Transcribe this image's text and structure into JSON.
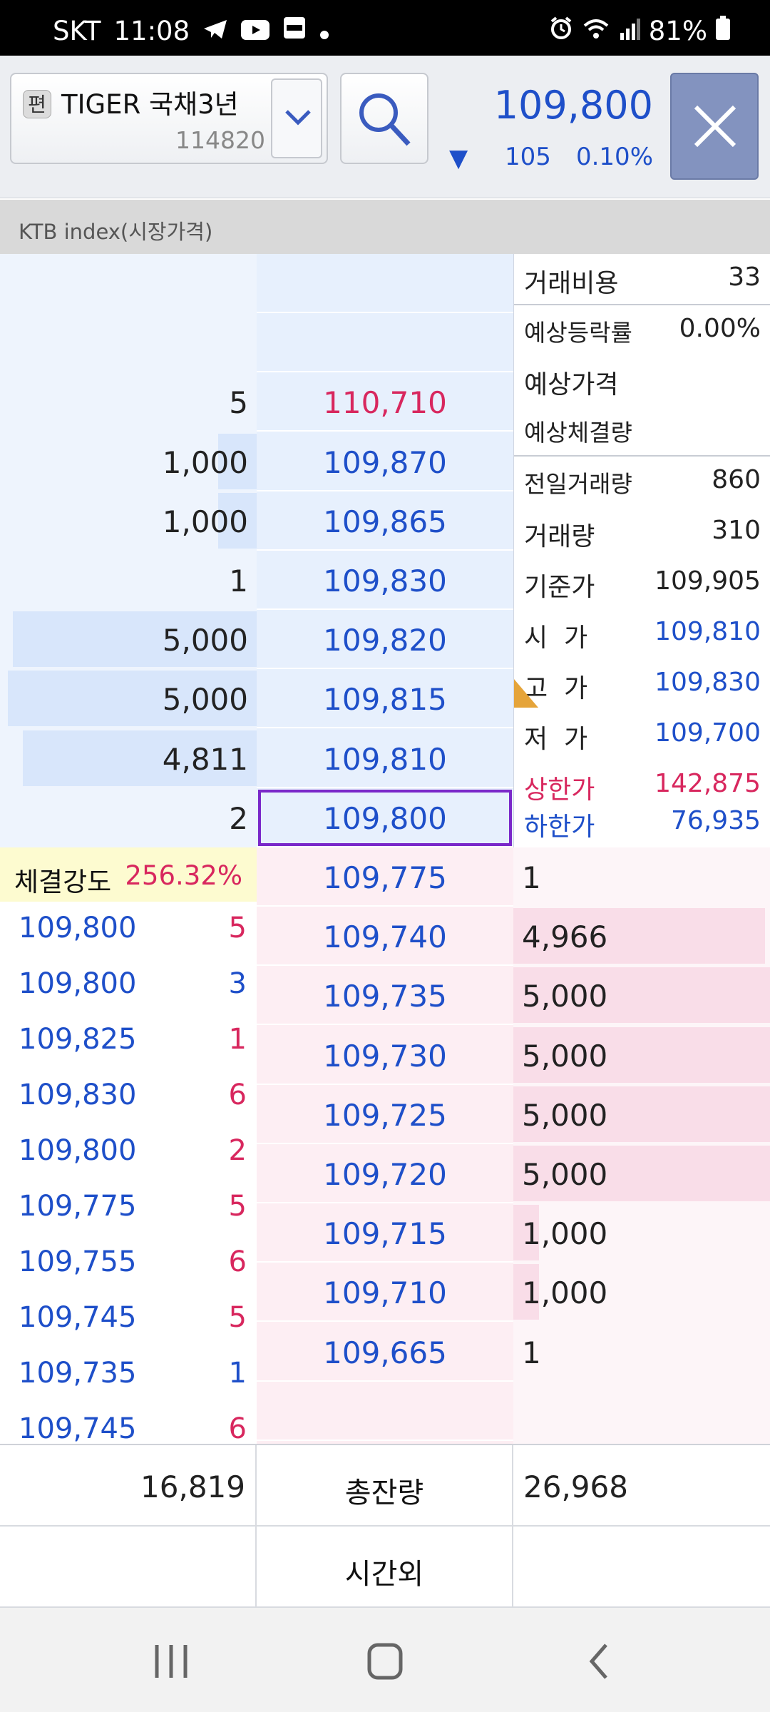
{
  "status_bar": {
    "carrier": "SKT",
    "time": "11:08",
    "battery": "81%",
    "left_icons": [
      "telegram-icon",
      "youtube-icon",
      "payco-icon",
      "dot-icon"
    ],
    "right_icons": [
      "alarm-icon",
      "wifi-icon",
      "signal-icon",
      "battery-icon"
    ]
  },
  "header": {
    "edit_badge": "편",
    "stock_name": "TIGER 국채3년",
    "stock_code": "114820",
    "current_price": "109,800",
    "change_arrow": "▼",
    "change_amount": "105",
    "change_rate": "0.10%"
  },
  "index_bar": {
    "label": "KTB index(시장가격)"
  },
  "ask_levels": [
    {
      "qty": "",
      "price": "",
      "fill": 0
    },
    {
      "qty": "",
      "price": "",
      "fill": 0
    },
    {
      "qty": "5",
      "price": "110,710",
      "fill": 0,
      "color": "#d8275e"
    },
    {
      "qty": "1,000",
      "price": "109,870",
      "fill": 0.15
    },
    {
      "qty": "1,000",
      "price": "109,865",
      "fill": 0.15
    },
    {
      "qty": "1",
      "price": "109,830",
      "fill": 0
    },
    {
      "qty": "5,000",
      "price": "109,820",
      "fill": 0.95
    },
    {
      "qty": "5,000",
      "price": "109,815",
      "fill": 0.97
    },
    {
      "qty": "4,811",
      "price": "109,810",
      "fill": 0.91
    },
    {
      "qty": "2",
      "price": "109,800",
      "fill": 0,
      "current": true
    }
  ],
  "bid_levels": [
    {
      "price": "109,775",
      "qty": "1",
      "fill": 0
    },
    {
      "price": "109,740",
      "qty": "4,966",
      "fill": 0.98
    },
    {
      "price": "109,735",
      "qty": "5,000",
      "fill": 1.0
    },
    {
      "price": "109,730",
      "qty": "5,000",
      "fill": 1.0
    },
    {
      "price": "109,725",
      "qty": "5,000",
      "fill": 1.0
    },
    {
      "price": "109,720",
      "qty": "5,000",
      "fill": 1.0
    },
    {
      "price": "109,715",
      "qty": "1,000",
      "fill": 0.1
    },
    {
      "price": "109,710",
      "qty": "1,000",
      "fill": 0.1
    },
    {
      "price": "109,665",
      "qty": "1",
      "fill": 0
    },
    {
      "price": "",
      "qty": "",
      "fill": 0
    }
  ],
  "info_panel": {
    "trade_cost_label": "거래비용",
    "trade_cost_value": "33",
    "exp_rate_label": "예상등락률",
    "exp_rate_value": "0.00%",
    "exp_price_label": "예상가격",
    "exp_volume_label": "예상체결량",
    "prev_volume_label": "전일거래량",
    "prev_volume_value": "860",
    "volume_label": "거래량",
    "volume_value": "310",
    "base_price_label": "기준가",
    "base_price_value": "109,905",
    "open_label": "시  가",
    "open_value": "109,810",
    "high_label": "고  가",
    "high_value": "109,830",
    "low_label": "저  가",
    "low_value": "109,700",
    "upper_limit_label": "상한가",
    "upper_limit_value": "142,875",
    "lower_limit_label": "하한가",
    "lower_limit_value": "76,935"
  },
  "trades": {
    "strength_label": "체결강도",
    "strength_value": "256.32%",
    "rows": [
      {
        "price": "109,800",
        "qty": "5",
        "color": "red"
      },
      {
        "price": "109,800",
        "qty": "3",
        "color": "blue"
      },
      {
        "price": "109,825",
        "qty": "1",
        "color": "red"
      },
      {
        "price": "109,830",
        "qty": "6",
        "color": "red"
      },
      {
        "price": "109,800",
        "qty": "2",
        "color": "red"
      },
      {
        "price": "109,775",
        "qty": "5",
        "color": "red"
      },
      {
        "price": "109,755",
        "qty": "6",
        "color": "red"
      },
      {
        "price": "109,745",
        "qty": "5",
        "color": "red"
      },
      {
        "price": "109,735",
        "qty": "1",
        "color": "blue"
      },
      {
        "price": "109,745",
        "qty": "6",
        "color": "red"
      }
    ]
  },
  "totals": {
    "ask_total": "16,819",
    "total_label": "총잔량",
    "bid_total": "26,968",
    "after_hours_label": "시간외"
  },
  "colors": {
    "blue": "#1e4fc9",
    "red": "#d8275e",
    "accent_box": "#7a28c9"
  }
}
